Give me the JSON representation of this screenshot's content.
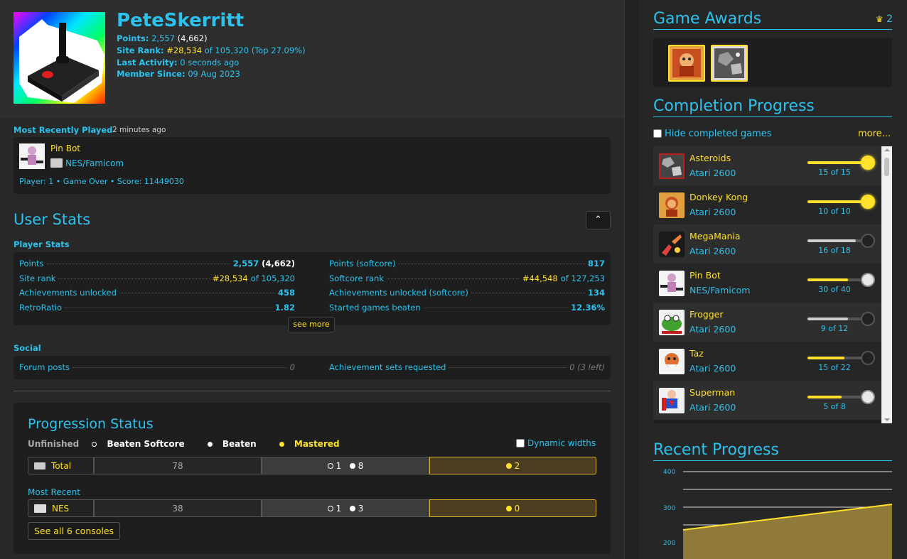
{
  "profile": {
    "username": "PeteSkerritt",
    "points_label": "Points:",
    "points": "2,557",
    "points_total": "(4,662)",
    "rank_label": "Site Rank:",
    "rank": "#28,534",
    "rank_of": "of 105,320 (Top 27.09%)",
    "activity_label": "Last Activity:",
    "activity": "0 seconds ago",
    "member_label": "Member Since:",
    "member": "09 Aug 2023"
  },
  "recently_played": {
    "label": "Most Recently Played",
    "time": "2 minutes ago",
    "game": "Pin Bot",
    "console": "NES/Famicom",
    "rich_presence": "Player: 1 • Game Over • Score: 11449030"
  },
  "user_stats": {
    "title": "User Stats",
    "collapse_icon": "chevron-up-icon",
    "player_stats_label": "Player Stats",
    "rows_left": [
      {
        "label": "Points",
        "value": "2,557",
        "extra": "(4,662)"
      },
      {
        "label": "Site rank",
        "value": "#28,534",
        "extra": "of 105,320"
      },
      {
        "label": "Achievements unlocked",
        "value": "458",
        "extra": ""
      },
      {
        "label": "RetroRatio",
        "value": "1.82",
        "extra": ""
      }
    ],
    "rows_right": [
      {
        "label": "Points (softcore)",
        "value": "817",
        "extra": ""
      },
      {
        "label": "Softcore rank",
        "value": "#44,548",
        "extra": "of 127,253"
      },
      {
        "label": "Achievements unlocked (softcore)",
        "value": "134",
        "extra": ""
      },
      {
        "label": "Started games beaten",
        "value": "12.36%",
        "extra": ""
      }
    ],
    "see_more": "see more",
    "social_label": "Social",
    "social_left": {
      "label": "Forum posts",
      "value": "0"
    },
    "social_right": {
      "label": "Achievement sets requested",
      "value": "0 (3 left)"
    }
  },
  "progression": {
    "title": "Progression Status",
    "legend_unfinished": "Unfinished",
    "legend_beaten_softcore": "Beaten Softcore",
    "legend_beaten": "Beaten",
    "legend_mastered": "Mastered",
    "dynamic_widths": "Dynamic widths",
    "total": {
      "name": "Total",
      "unfinished": "78",
      "beaten_softcore": "1",
      "beaten": "8",
      "mastered": "2"
    },
    "most_recent_label": "Most Recent",
    "recent": {
      "name": "NES",
      "unfinished": "38",
      "beaten_softcore": "1",
      "beaten": "3",
      "mastered": "0"
    },
    "see_all": "See all 6 consoles"
  },
  "game_awards": {
    "title": "Game Awards",
    "count": "2",
    "count_icon": "crown-icon"
  },
  "completion": {
    "title": "Completion Progress",
    "hide_completed": "Hide completed games",
    "more": "more...",
    "games": [
      {
        "name": "Asteroids",
        "console": "Atari 2600",
        "count": "15 of 15",
        "progress": 1.0,
        "status": "mastered"
      },
      {
        "name": "Donkey Kong",
        "console": "Atari 2600",
        "count": "10 of 10",
        "progress": 1.0,
        "status": "mastered"
      },
      {
        "name": "MegaMania",
        "console": "Atari 2600",
        "count": "16 of 18",
        "progress": 0.89,
        "status": "softcore"
      },
      {
        "name": "Pin Bot",
        "console": "NES/Famicom",
        "count": "30 of 40",
        "progress": 0.75,
        "status": "beaten"
      },
      {
        "name": "Frogger",
        "console": "Atari 2600",
        "count": "9 of 12",
        "progress": 0.75,
        "status": "softcore"
      },
      {
        "name": "Taz",
        "console": "Atari 2600",
        "count": "15 of 22",
        "progress": 0.68,
        "status": "none"
      },
      {
        "name": "Superman",
        "console": "Atari 2600",
        "count": "5 of 8",
        "progress": 0.63,
        "status": "beaten"
      }
    ]
  },
  "recent_progress": {
    "title": "Recent Progress",
    "y_ticks": [
      "400",
      "300",
      "200"
    ]
  },
  "colors": {
    "accent": "#2bc3ee",
    "gold": "#ffe02b",
    "panel": "#1e1e1e"
  }
}
